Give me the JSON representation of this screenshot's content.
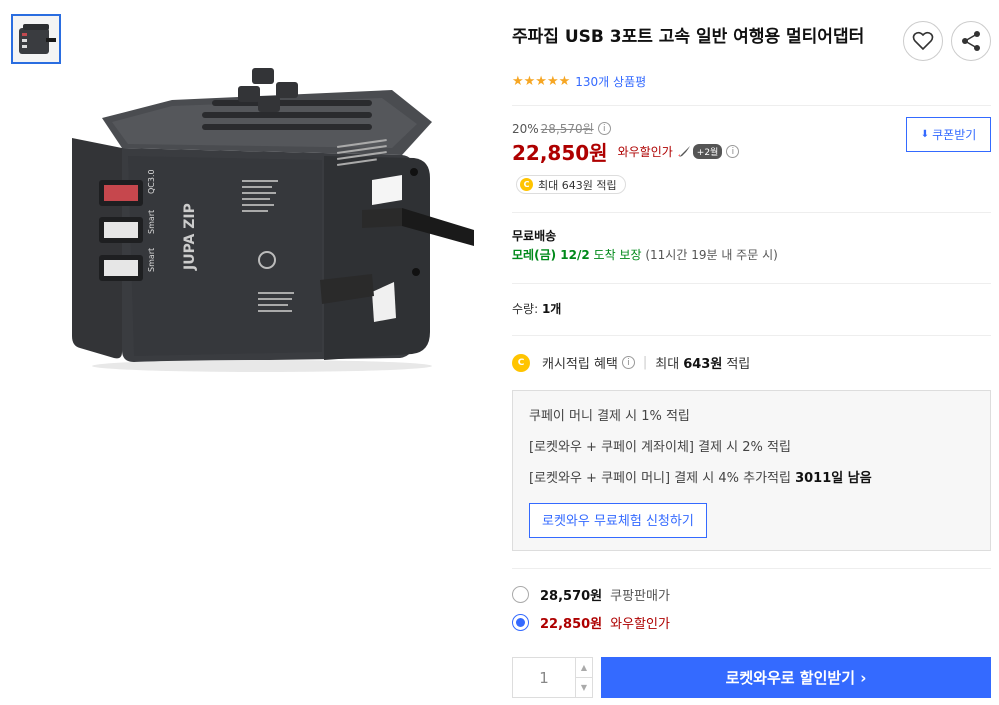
{
  "product": {
    "title": "주파집 USB 3포트 고속 일반 여행용 멀티어댑터",
    "rating_stars": "★★★★★",
    "review_count": "130개 상품평"
  },
  "price": {
    "discount_rate": "20%",
    "original_price": "28,570원",
    "sale_price": "22,850원",
    "wow_label": "와우할인가",
    "wow_badge": "+2월",
    "coupon_button": "쿠폰받기",
    "cash_chip": "최대 643원 적립"
  },
  "shipping": {
    "title": "무료배송",
    "date": "모레(금) 12/2",
    "guarantee": "도착 보장",
    "note": "(11시간 19분 내 주문 시)"
  },
  "quantity": {
    "label": "수량:",
    "value": "1개"
  },
  "cash_benefit": {
    "label": "캐시적립 혜택",
    "max": "최대",
    "amount": "643원",
    "suffix": "적립"
  },
  "benefit_box": {
    "line1": "쿠페이 머니 결제 시 1% 적립",
    "line2": "[로켓와우 + 쿠페이 계좌이체] 결제 시 2% 적립",
    "line3_prefix": "[로켓와우 + 쿠페이 머니] 결제 시 4% 추가적립",
    "line3_bold": "3011일 남음",
    "trial_button": "로켓와우 무료체험 신청하기"
  },
  "options": [
    {
      "price": "28,570원",
      "label": "쿠팡판매가",
      "selected": false
    },
    {
      "price": "22,850원",
      "label": "와우할인가",
      "selected": true
    }
  ],
  "cart": {
    "qty_value": "1",
    "buy_button": "로켓와우로 할인받기 ›"
  },
  "image_text": {
    "brand": "JUPA ZIP",
    "port1": "QC3.0",
    "port2": "Smart",
    "port3": "Smart"
  },
  "colors": {
    "accent": "#346aff",
    "price_red": "#ae0000",
    "green": "#00891a",
    "star": "#f6a623"
  }
}
